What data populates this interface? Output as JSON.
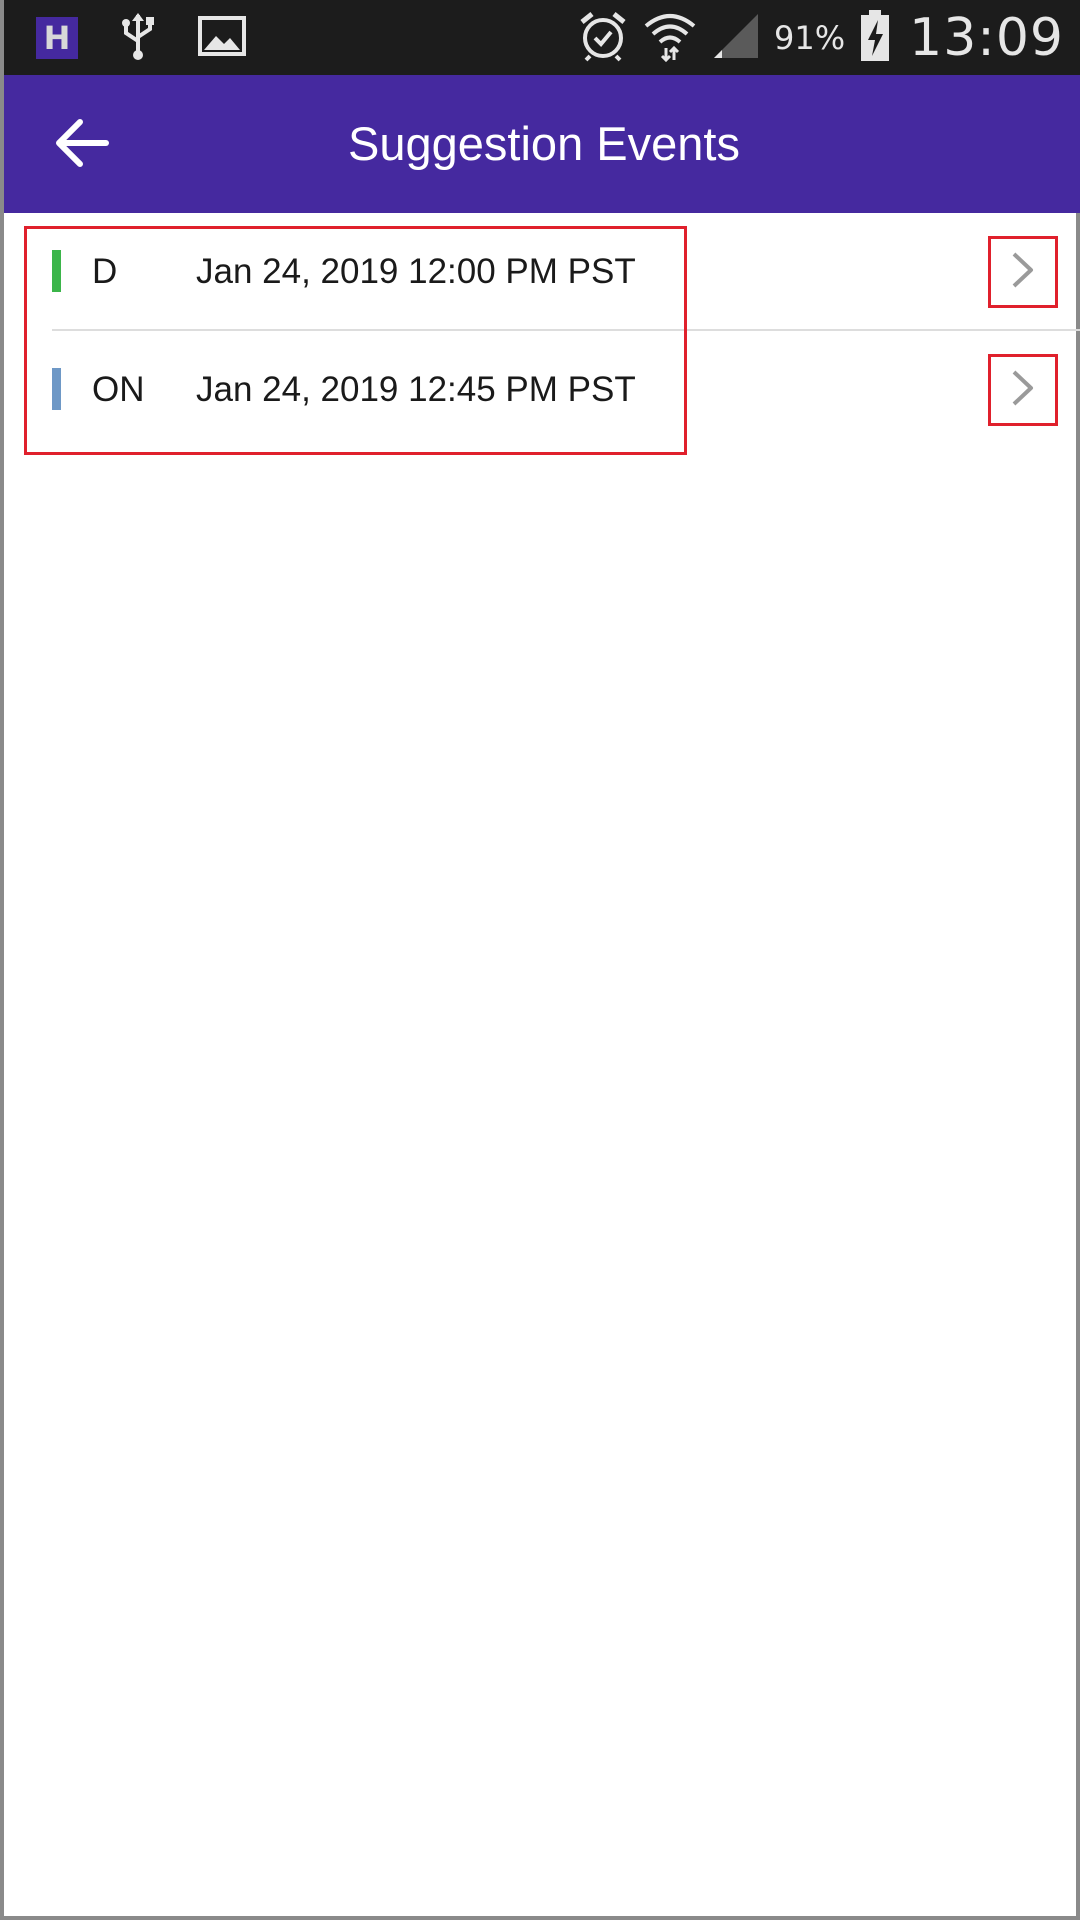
{
  "status_bar": {
    "notification_icons": [
      "h-app-icon",
      "usb-icon",
      "image-icon"
    ],
    "h_badge_letter": "H",
    "battery_percent": "91%",
    "time": "13:09"
  },
  "app_bar": {
    "title": "Suggestion Events",
    "back_icon": "arrow-left-icon"
  },
  "events": [
    {
      "type": "D",
      "datetime": "Jan 24, 2019 12:00 PM PST",
      "color": "#3bb54a"
    },
    {
      "type": "ON",
      "datetime": "Jan 24, 2019 12:45 PM PST",
      "color": "#6e98c6"
    }
  ],
  "colors": {
    "primary": "#45299f",
    "status_bar": "#1c1c1c",
    "highlight": "#e0202c"
  }
}
